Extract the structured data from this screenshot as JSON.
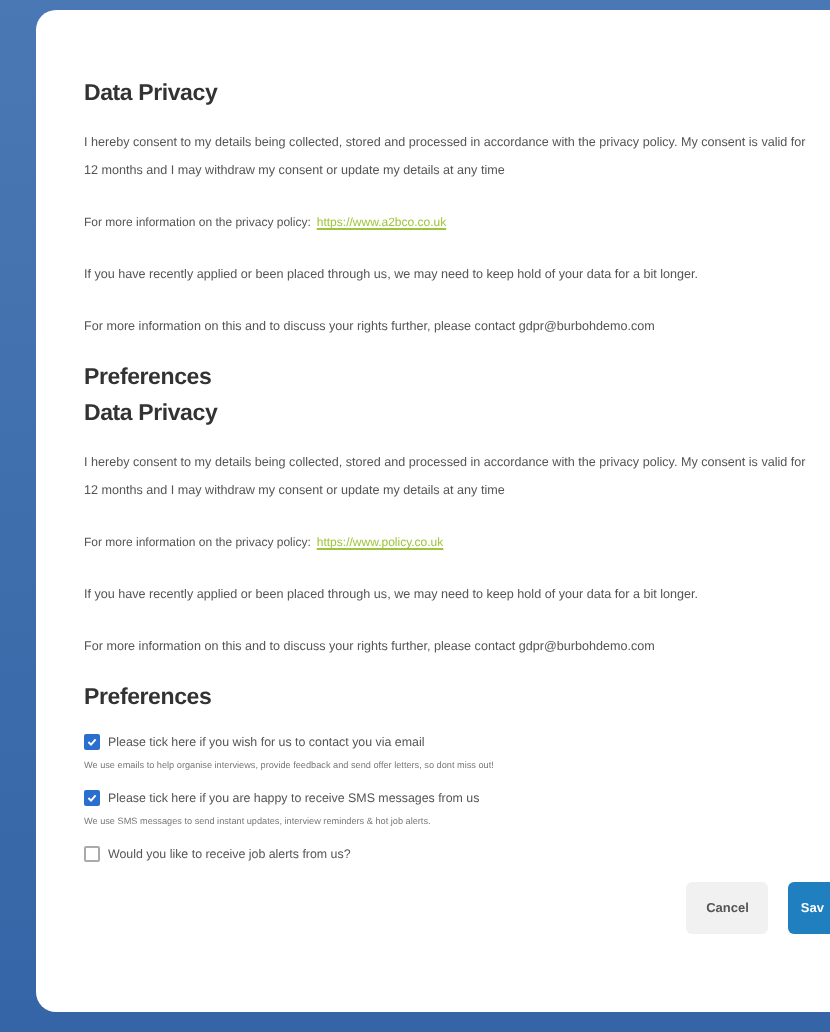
{
  "blocks": [
    {
      "kind": "heading",
      "text": "Data Privacy"
    },
    {
      "kind": "paragraph",
      "text": "I hereby consent to my details being collected, stored and processed in accordance with the privacy policy. My consent is valid for 12 months and I may withdraw my consent or update my details at any time"
    },
    {
      "kind": "link",
      "text": "For more information on the privacy policy:",
      "link": "https://www.a2bco.co.uk"
    },
    {
      "kind": "paragraph",
      "text": "If you have recently applied or been placed through us, we may need to keep hold of your data for a bit longer."
    },
    {
      "kind": "paragraph",
      "text": "For more information on this and to discuss your rights further, please contact gdpr@burbohdemo.com"
    },
    {
      "kind": "heading",
      "text": "Preferences"
    },
    {
      "kind": "heading",
      "text": "Data Privacy"
    },
    {
      "kind": "paragraph",
      "text": "I hereby consent to my details being collected, stored and processed in accordance with the privacy policy. My consent is valid for 12 months and I may withdraw my consent or update my details at any time"
    },
    {
      "kind": "link",
      "text": "For more information on the privacy policy:",
      "link": "https://www.policy.co.uk"
    },
    {
      "kind": "paragraph",
      "text": "If you have recently applied or been placed through us, we may need to keep hold of your data for a bit longer."
    },
    {
      "kind": "paragraph",
      "text": "For more information on this and to discuss your rights further, please contact gdpr@burbohdemo.com"
    },
    {
      "kind": "heading",
      "text": "Preferences"
    },
    {
      "kind": "checkbox",
      "label": "Please tick here if you wish for us to contact you via email",
      "note": "We use emails to help organise interviews, provide feedback and send offer letters, so dont miss out!",
      "checked": true
    },
    {
      "kind": "checkbox",
      "label": "Please tick here if you are happy to receive SMS messages from us",
      "note": "We use SMS messages to send instant updates, interview reminders & hot job alerts.",
      "checked": true
    },
    {
      "kind": "checkbox",
      "label": "Would you like to receive job alerts from us?",
      "checked": false
    }
  ],
  "buttons": [
    {
      "label": "Cancel",
      "kind": "secondary"
    },
    {
      "label": "Sav",
      "kind": "primary"
    }
  ]
}
